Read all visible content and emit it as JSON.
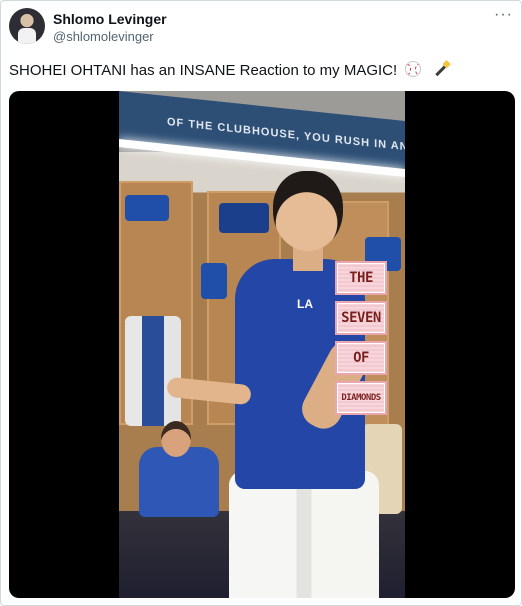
{
  "tweet": {
    "author": {
      "display_name": "Shlomo Levinger",
      "handle": "@shlomolevinger"
    },
    "more_label": "···",
    "text": "SHOHEI OHTANI has an INSANE Reaction to my MAGIC!",
    "emojis": [
      "baseball-icon",
      "magic-wand-icon"
    ]
  },
  "media": {
    "banner_text": "OF THE CLUBHOUSE, YOU RUSH IN AND OUT",
    "overlay_words": [
      "THE",
      "SEVEN",
      "OF",
      "DIAMONDS"
    ],
    "chest_logo": "LA"
  }
}
